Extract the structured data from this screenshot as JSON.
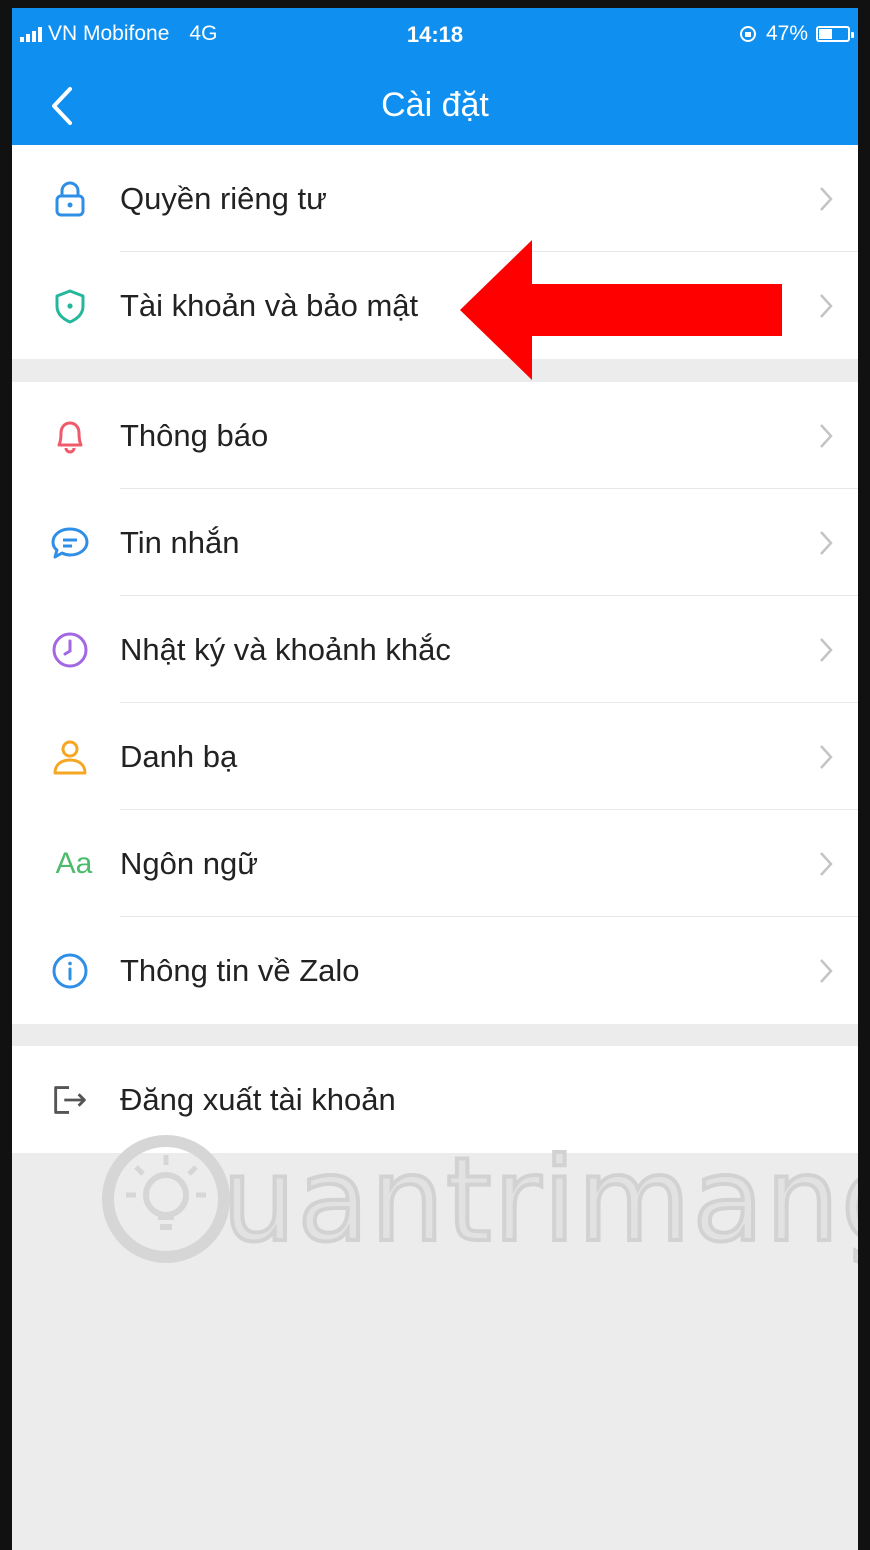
{
  "status_bar": {
    "carrier": "VN Mobifone",
    "network": "4G",
    "time": "14:18",
    "battery": "47%",
    "battery_level": 0.47
  },
  "header": {
    "title": "Cài đặt",
    "back_icon": "chevron-left-icon"
  },
  "groups": [
    [
      {
        "label": "Quyền riêng tư",
        "icon": "lock-icon"
      },
      {
        "label": "Tài khoản và bảo mật",
        "icon": "shield-icon"
      }
    ],
    [
      {
        "label": "Thông báo",
        "icon": "bell-icon"
      },
      {
        "label": "Tin nhắn",
        "icon": "message-icon"
      },
      {
        "label": "Nhật ký và khoảnh khắc",
        "icon": "clock-icon"
      },
      {
        "label": "Danh bạ",
        "icon": "person-icon"
      },
      {
        "label": "Ngôn ngữ",
        "icon": "language-icon",
        "icon_text": "Aa"
      },
      {
        "label": "Thông tin về Zalo",
        "icon": "info-icon"
      }
    ],
    [
      {
        "label": "Đăng xuất tài khoản",
        "icon": "logout-icon"
      }
    ]
  ],
  "watermark": {
    "text": "uantrimang"
  },
  "colors": {
    "header_bg": "#0f8ff0",
    "lock": "#2f8fe6",
    "shield": "#25b79c",
    "bell": "#ef5b6a",
    "message": "#2f8fe6",
    "clock": "#a367e3",
    "person": "#f5a623",
    "language": "#4cbb6c",
    "info": "#2f8fe6",
    "logout": "#555555",
    "annotation_arrow": "#ff0000"
  }
}
